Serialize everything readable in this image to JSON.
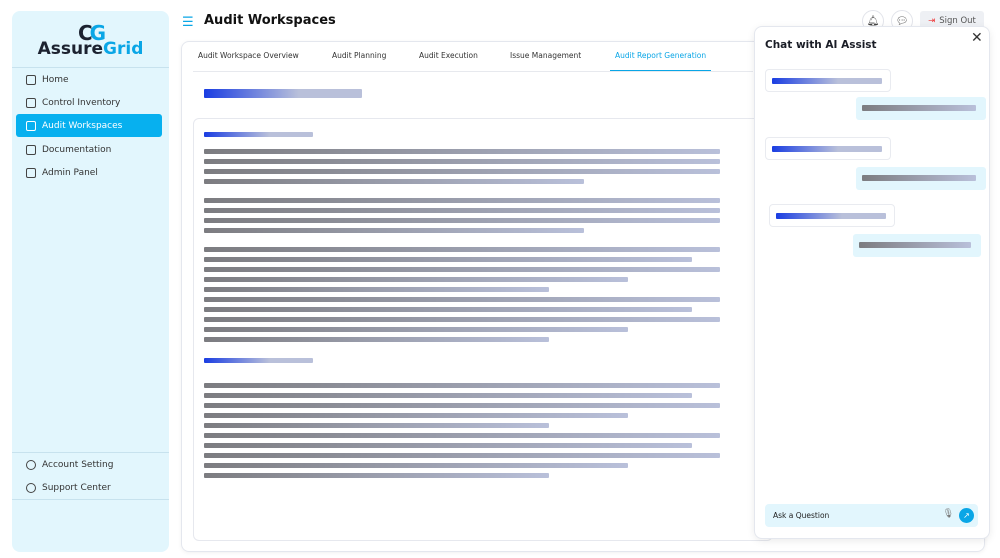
{
  "brand": {
    "mark": "CG",
    "name_a": "Assure",
    "name_b": "Grid"
  },
  "sidebar": {
    "items": [
      {
        "label": "Home",
        "icon": "home-icon"
      },
      {
        "label": "Control Inventory",
        "icon": "box-icon"
      },
      {
        "label": "Audit Workspaces",
        "icon": "clipboard-icon",
        "active": true
      },
      {
        "label": "Documentation",
        "icon": "document-icon"
      },
      {
        "label": "Admin Panel",
        "icon": "user-icon"
      }
    ],
    "bottom": [
      {
        "label": "Account Setting",
        "icon": "users-icon"
      },
      {
        "label": "Support Center",
        "icon": "help-icon"
      }
    ]
  },
  "header": {
    "title": "Audit Workspaces",
    "sign_out": "Sign Out"
  },
  "tabs": [
    "Audit Workspace Overview",
    "Audit Planning",
    "Audit Execution",
    "Issue Management",
    "Audit Report Generation"
  ],
  "active_tab": "Audit Report Generation",
  "chat": {
    "title": "Chat with AI Assist",
    "placeholder": "Ask a Question"
  },
  "colors": {
    "accent": "#07b0ef",
    "sidebar_bg": "#e2f6fd",
    "heading_blue": "#1a3de2"
  }
}
